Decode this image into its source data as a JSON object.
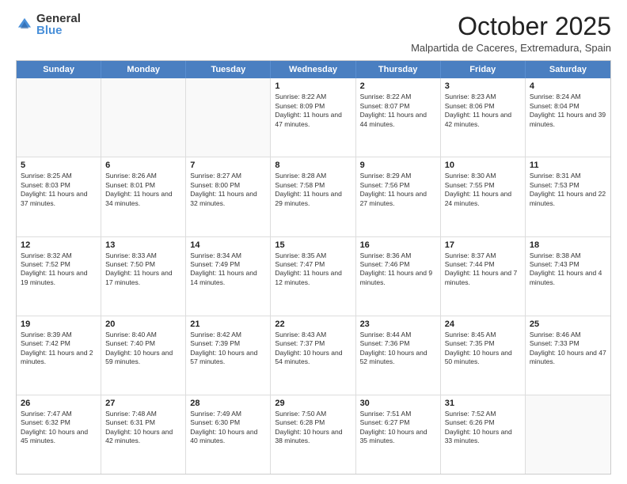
{
  "logo": {
    "general": "General",
    "blue": "Blue"
  },
  "title": "October 2025",
  "subtitle": "Malpartida de Caceres, Extremadura, Spain",
  "headers": [
    "Sunday",
    "Monday",
    "Tuesday",
    "Wednesday",
    "Thursday",
    "Friday",
    "Saturday"
  ],
  "rows": [
    [
      {
        "day": "",
        "info": ""
      },
      {
        "day": "",
        "info": ""
      },
      {
        "day": "",
        "info": ""
      },
      {
        "day": "1",
        "info": "Sunrise: 8:22 AM\nSunset: 8:09 PM\nDaylight: 11 hours and 47 minutes."
      },
      {
        "day": "2",
        "info": "Sunrise: 8:22 AM\nSunset: 8:07 PM\nDaylight: 11 hours and 44 minutes."
      },
      {
        "day": "3",
        "info": "Sunrise: 8:23 AM\nSunset: 8:06 PM\nDaylight: 11 hours and 42 minutes."
      },
      {
        "day": "4",
        "info": "Sunrise: 8:24 AM\nSunset: 8:04 PM\nDaylight: 11 hours and 39 minutes."
      }
    ],
    [
      {
        "day": "5",
        "info": "Sunrise: 8:25 AM\nSunset: 8:03 PM\nDaylight: 11 hours and 37 minutes."
      },
      {
        "day": "6",
        "info": "Sunrise: 8:26 AM\nSunset: 8:01 PM\nDaylight: 11 hours and 34 minutes."
      },
      {
        "day": "7",
        "info": "Sunrise: 8:27 AM\nSunset: 8:00 PM\nDaylight: 11 hours and 32 minutes."
      },
      {
        "day": "8",
        "info": "Sunrise: 8:28 AM\nSunset: 7:58 PM\nDaylight: 11 hours and 29 minutes."
      },
      {
        "day": "9",
        "info": "Sunrise: 8:29 AM\nSunset: 7:56 PM\nDaylight: 11 hours and 27 minutes."
      },
      {
        "day": "10",
        "info": "Sunrise: 8:30 AM\nSunset: 7:55 PM\nDaylight: 11 hours and 24 minutes."
      },
      {
        "day": "11",
        "info": "Sunrise: 8:31 AM\nSunset: 7:53 PM\nDaylight: 11 hours and 22 minutes."
      }
    ],
    [
      {
        "day": "12",
        "info": "Sunrise: 8:32 AM\nSunset: 7:52 PM\nDaylight: 11 hours and 19 minutes."
      },
      {
        "day": "13",
        "info": "Sunrise: 8:33 AM\nSunset: 7:50 PM\nDaylight: 11 hours and 17 minutes."
      },
      {
        "day": "14",
        "info": "Sunrise: 8:34 AM\nSunset: 7:49 PM\nDaylight: 11 hours and 14 minutes."
      },
      {
        "day": "15",
        "info": "Sunrise: 8:35 AM\nSunset: 7:47 PM\nDaylight: 11 hours and 12 minutes."
      },
      {
        "day": "16",
        "info": "Sunrise: 8:36 AM\nSunset: 7:46 PM\nDaylight: 11 hours and 9 minutes."
      },
      {
        "day": "17",
        "info": "Sunrise: 8:37 AM\nSunset: 7:44 PM\nDaylight: 11 hours and 7 minutes."
      },
      {
        "day": "18",
        "info": "Sunrise: 8:38 AM\nSunset: 7:43 PM\nDaylight: 11 hours and 4 minutes."
      }
    ],
    [
      {
        "day": "19",
        "info": "Sunrise: 8:39 AM\nSunset: 7:42 PM\nDaylight: 11 hours and 2 minutes."
      },
      {
        "day": "20",
        "info": "Sunrise: 8:40 AM\nSunset: 7:40 PM\nDaylight: 10 hours and 59 minutes."
      },
      {
        "day": "21",
        "info": "Sunrise: 8:42 AM\nSunset: 7:39 PM\nDaylight: 10 hours and 57 minutes."
      },
      {
        "day": "22",
        "info": "Sunrise: 8:43 AM\nSunset: 7:37 PM\nDaylight: 10 hours and 54 minutes."
      },
      {
        "day": "23",
        "info": "Sunrise: 8:44 AM\nSunset: 7:36 PM\nDaylight: 10 hours and 52 minutes."
      },
      {
        "day": "24",
        "info": "Sunrise: 8:45 AM\nSunset: 7:35 PM\nDaylight: 10 hours and 50 minutes."
      },
      {
        "day": "25",
        "info": "Sunrise: 8:46 AM\nSunset: 7:33 PM\nDaylight: 10 hours and 47 minutes."
      }
    ],
    [
      {
        "day": "26",
        "info": "Sunrise: 7:47 AM\nSunset: 6:32 PM\nDaylight: 10 hours and 45 minutes."
      },
      {
        "day": "27",
        "info": "Sunrise: 7:48 AM\nSunset: 6:31 PM\nDaylight: 10 hours and 42 minutes."
      },
      {
        "day": "28",
        "info": "Sunrise: 7:49 AM\nSunset: 6:30 PM\nDaylight: 10 hours and 40 minutes."
      },
      {
        "day": "29",
        "info": "Sunrise: 7:50 AM\nSunset: 6:28 PM\nDaylight: 10 hours and 38 minutes."
      },
      {
        "day": "30",
        "info": "Sunrise: 7:51 AM\nSunset: 6:27 PM\nDaylight: 10 hours and 35 minutes."
      },
      {
        "day": "31",
        "info": "Sunrise: 7:52 AM\nSunset: 6:26 PM\nDaylight: 10 hours and 33 minutes."
      },
      {
        "day": "",
        "info": ""
      }
    ]
  ]
}
